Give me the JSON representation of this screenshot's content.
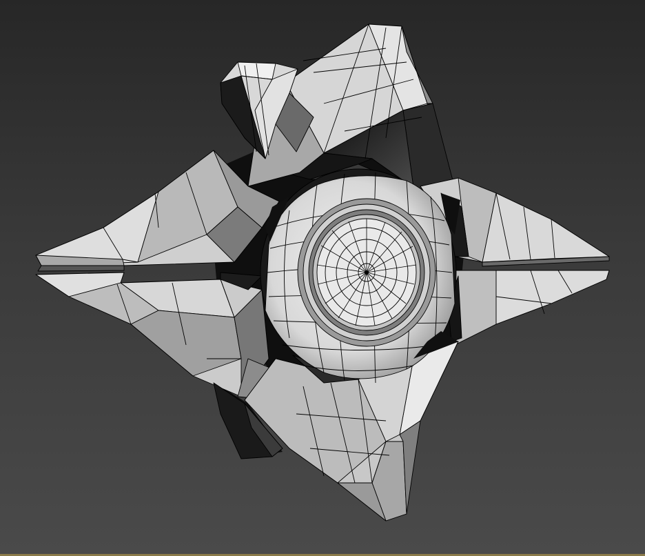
{
  "viewport": {
    "background_top": "#272727",
    "background_bottom": "#4a4a4a",
    "frame_edge_color": "#8a7a4a",
    "shading": "wireframe-on-shaded",
    "wire_color": "#000000"
  },
  "model": {
    "icon": "ghost-shell-icon",
    "surface_light": "#e6e6e6",
    "surface_mid": "#b8b8b8",
    "surface_dark": "#5c5c5c",
    "surface_shadow": "#141414"
  }
}
